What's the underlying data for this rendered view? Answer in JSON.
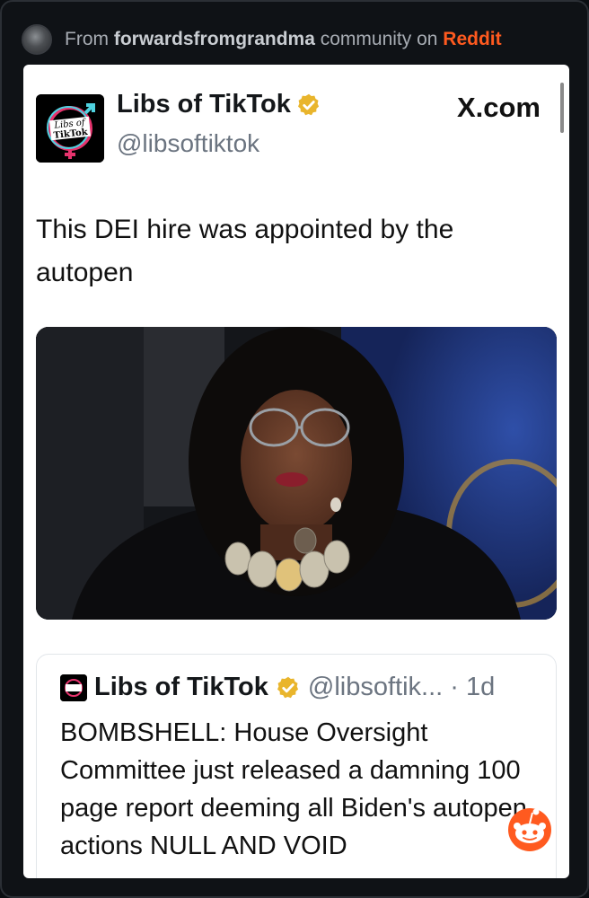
{
  "header": {
    "prefix": "From",
    "community": "forwardsfromgrandma",
    "middle": "community on",
    "platform": "Reddit"
  },
  "tweet": {
    "avatar_text_line1": "Libs of",
    "avatar_text_line2": "TikTok",
    "display_name": "Libs of TikTok",
    "handle": "@libsoftiktok",
    "site": "X.com",
    "text": "This DEI hire was appointed by the autopen"
  },
  "quoted_tweet": {
    "display_name": "Libs of TikTok",
    "handle_time": "@libsoftik... · 1d",
    "text": "BOMBSHELL: House Oversight Committee just released a damning 100 page report deeming all Biden's autopen actions NULL AND VOID"
  },
  "icons": {
    "verified": "verified-badge-icon",
    "reddit": "reddit-snoo-icon"
  },
  "colors": {
    "reddit_orange": "#ff5a1f",
    "verified_gold": "#e9b52c",
    "background": "#0f1216"
  }
}
